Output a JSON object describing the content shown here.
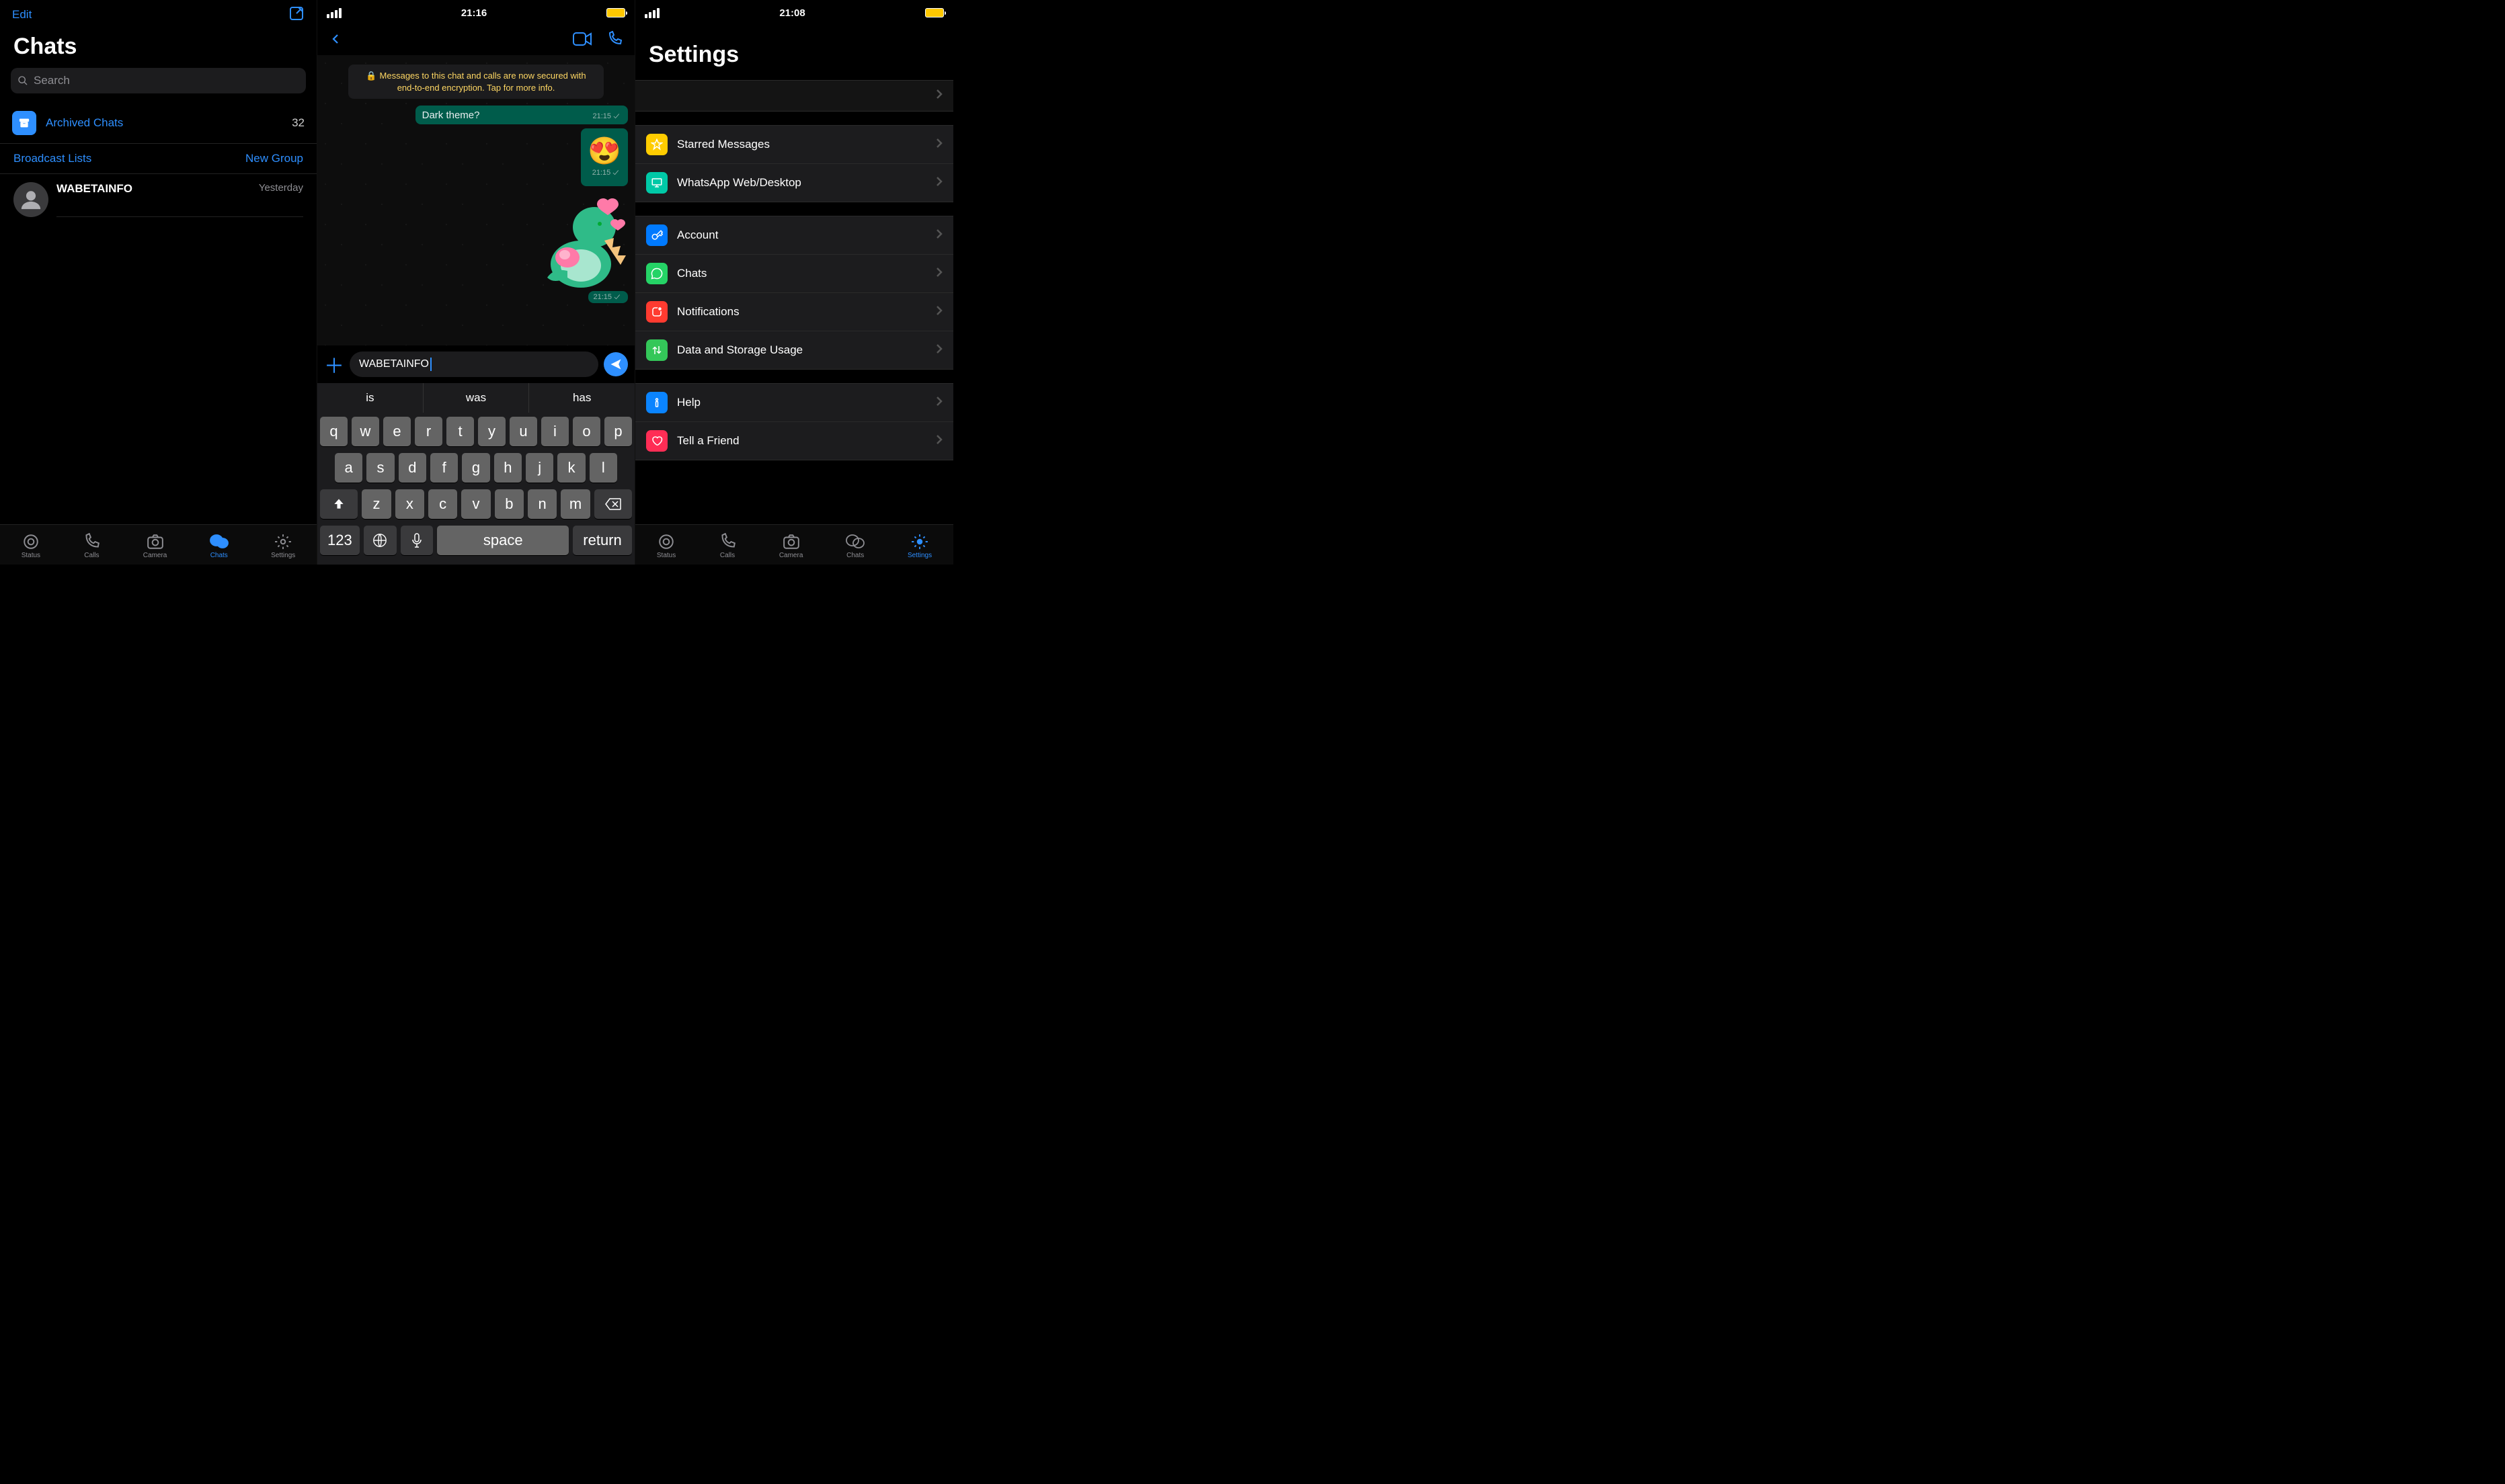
{
  "panel1": {
    "edit": "Edit",
    "title": "Chats",
    "search_placeholder": "Search",
    "archived_label": "Archived Chats",
    "archived_count": "32",
    "broadcast": "Broadcast Lists",
    "new_group": "New Group",
    "chat_name": "WABETAINFO",
    "chat_time": "Yesterday",
    "tabs": [
      "Status",
      "Calls",
      "Camera",
      "Chats",
      "Settings"
    ],
    "active_tab": 3
  },
  "panel2": {
    "time": "21:16",
    "encryption_notice": "Messages to this chat and calls are now secured with end-to-end encryption. Tap for more info.",
    "msg1_text": "Dark theme?",
    "msg1_time": "21:15",
    "msg2_time": "21:15",
    "msg2_emoji": "😍",
    "sticker_time": "21:15",
    "input_value": "WABETAINFO",
    "suggestions": [
      "is",
      "was",
      "has"
    ],
    "keyboard": {
      "row1": [
        "q",
        "w",
        "e",
        "r",
        "t",
        "y",
        "u",
        "i",
        "o",
        "p"
      ],
      "row2": [
        "a",
        "s",
        "d",
        "f",
        "g",
        "h",
        "j",
        "k",
        "l"
      ],
      "row3": [
        "z",
        "x",
        "c",
        "v",
        "b",
        "n",
        "m"
      ],
      "num_key": "123",
      "space_key": "space",
      "return_key": "return"
    }
  },
  "panel3": {
    "time": "21:08",
    "title": "Settings",
    "groups": [
      [
        {
          "icon": "star",
          "color": "bg-yellow",
          "label": "Starred Messages"
        },
        {
          "icon": "desktop",
          "color": "bg-teal",
          "label": "WhatsApp Web/Desktop"
        }
      ],
      [
        {
          "icon": "key",
          "color": "bg-blue",
          "label": "Account"
        },
        {
          "icon": "whatsapp",
          "color": "bg-green",
          "label": "Chats"
        },
        {
          "icon": "bell",
          "color": "bg-red",
          "label": "Notifications"
        },
        {
          "icon": "arrows",
          "color": "bg-green2",
          "label": "Data and Storage Usage"
        }
      ],
      [
        {
          "icon": "info",
          "color": "bg-blue2",
          "label": "Help"
        },
        {
          "icon": "heart",
          "color": "bg-red2",
          "label": "Tell a Friend"
        }
      ]
    ],
    "tabs": [
      "Status",
      "Calls",
      "Camera",
      "Chats",
      "Settings"
    ],
    "active_tab": 4
  }
}
